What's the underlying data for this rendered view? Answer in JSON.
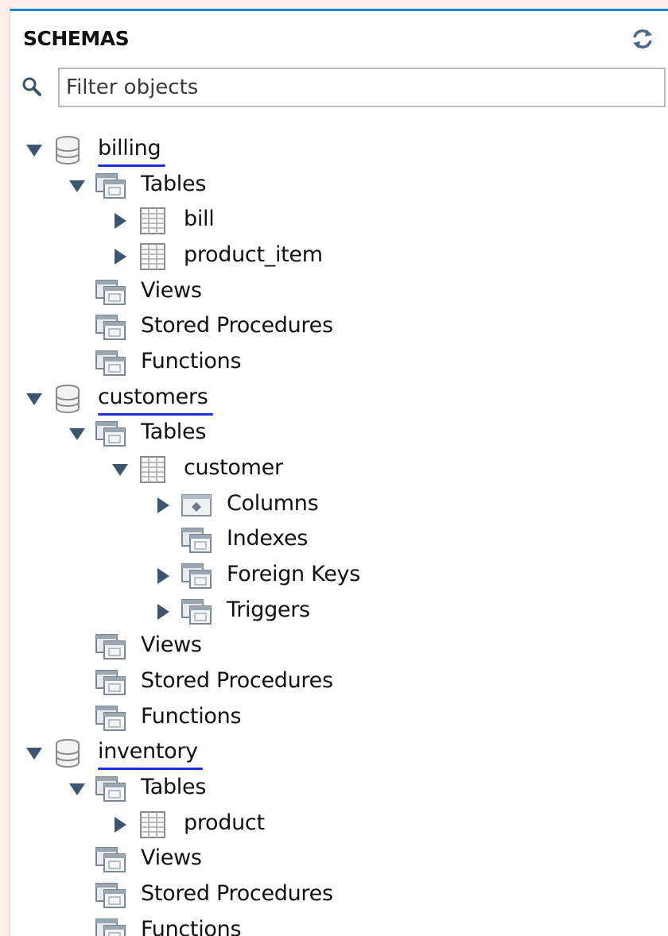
{
  "panel": {
    "title": "SCHEMAS",
    "refresh_icon": "refresh-icon",
    "search_icon": "search-icon",
    "filter_placeholder": "Filter objects",
    "filter_value": ""
  },
  "tree": [
    {
      "label": "billing",
      "type": "schema",
      "expanded": true,
      "underlined": true
    },
    {
      "label": "Tables",
      "type": "folder",
      "expanded": true
    },
    {
      "label": "bill",
      "type": "table",
      "expanded": false
    },
    {
      "label": "product_item",
      "type": "table",
      "expanded": false
    },
    {
      "label": "Views",
      "type": "folder"
    },
    {
      "label": "Stored Procedures",
      "type": "folder"
    },
    {
      "label": "Functions",
      "type": "folder"
    },
    {
      "label": "customers",
      "type": "schema",
      "expanded": true,
      "underlined": true
    },
    {
      "label": "Tables",
      "type": "folder",
      "expanded": true
    },
    {
      "label": "customer",
      "type": "table",
      "expanded": true
    },
    {
      "label": "Columns",
      "type": "columns",
      "expanded": false
    },
    {
      "label": "Indexes",
      "type": "folder"
    },
    {
      "label": "Foreign Keys",
      "type": "folder",
      "expanded": false
    },
    {
      "label": "Triggers",
      "type": "folder",
      "expanded": false
    },
    {
      "label": "Views",
      "type": "folder"
    },
    {
      "label": "Stored Procedures",
      "type": "folder"
    },
    {
      "label": "Functions",
      "type": "folder"
    },
    {
      "label": "inventory",
      "type": "schema",
      "expanded": true,
      "underlined": true
    },
    {
      "label": "Tables",
      "type": "folder",
      "expanded": true
    },
    {
      "label": "product",
      "type": "table",
      "expanded": false
    },
    {
      "label": "Views",
      "type": "folder"
    },
    {
      "label": "Stored Procedures",
      "type": "folder"
    },
    {
      "label": "Functions",
      "type": "folder"
    }
  ],
  "colors": {
    "accent_border": "#1c86d6",
    "underline": "#1a2fd6",
    "caret": "#3d5570",
    "background": "#fbeeea"
  }
}
